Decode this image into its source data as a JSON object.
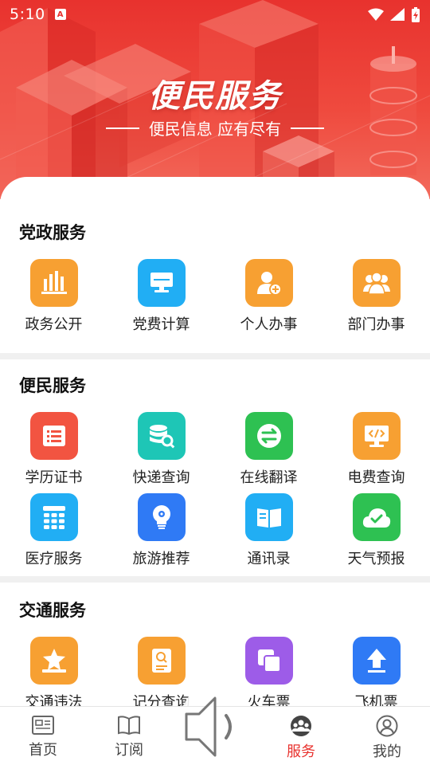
{
  "status_bar": {
    "time": "5:10",
    "notif": "A"
  },
  "banner": {
    "title": "便民服务",
    "subtitle": "便民信息 应有尽有"
  },
  "sections": [
    {
      "title": "党政服务",
      "items": [
        {
          "label": "政务公开",
          "icon": "bar-chart-icon",
          "color": "#f7a032"
        },
        {
          "label": "党费计算",
          "icon": "monitor-icon",
          "color": "#21aef4"
        },
        {
          "label": "个人办事",
          "icon": "user-add-icon",
          "color": "#f7a032"
        },
        {
          "label": "部门办事",
          "icon": "users-icon",
          "color": "#f7a032"
        }
      ]
    },
    {
      "title": "便民服务",
      "items": [
        {
          "label": "学历证书",
          "icon": "certificate-icon",
          "color": "#f25441"
        },
        {
          "label": "快递查询",
          "icon": "database-search-icon",
          "color": "#1ec6b6"
        },
        {
          "label": "在线翻译",
          "icon": "exchange-icon",
          "color": "#2ec152"
        },
        {
          "label": "电费查询",
          "icon": "code-monitor-icon",
          "color": "#f7a032"
        },
        {
          "label": "医疗服务",
          "icon": "grid-calendar-icon",
          "color": "#21aef4"
        },
        {
          "label": "旅游推荐",
          "icon": "bulb-icon",
          "color": "#2f7af5"
        },
        {
          "label": "通讯录",
          "icon": "book-icon",
          "color": "#21aef4"
        },
        {
          "label": "天气预报",
          "icon": "cloud-check-icon",
          "color": "#2ec152"
        }
      ]
    },
    {
      "title": "交通服务",
      "items": [
        {
          "label": "交通违法",
          "icon": "star-badge-icon",
          "color": "#f7a032"
        },
        {
          "label": "记分查询",
          "icon": "document-search-icon",
          "color": "#f7a032"
        },
        {
          "label": "火车票",
          "icon": "copy-icon",
          "color": "#9d5ce8"
        },
        {
          "label": "飞机票",
          "icon": "upload-icon",
          "color": "#2f7af5"
        }
      ]
    }
  ],
  "bottom_nav": [
    {
      "label": "首页",
      "icon": "newspaper-icon",
      "active": false
    },
    {
      "label": "订阅",
      "icon": "open-book-icon",
      "active": false
    },
    {
      "label": "",
      "icon": "speaker-icon",
      "active": false
    },
    {
      "label": "服务",
      "icon": "group-icon",
      "active": true
    },
    {
      "label": "我的",
      "icon": "profile-icon",
      "active": false
    }
  ],
  "colors": {
    "brand": "#e8322e",
    "active_nav": "#e8322e"
  }
}
